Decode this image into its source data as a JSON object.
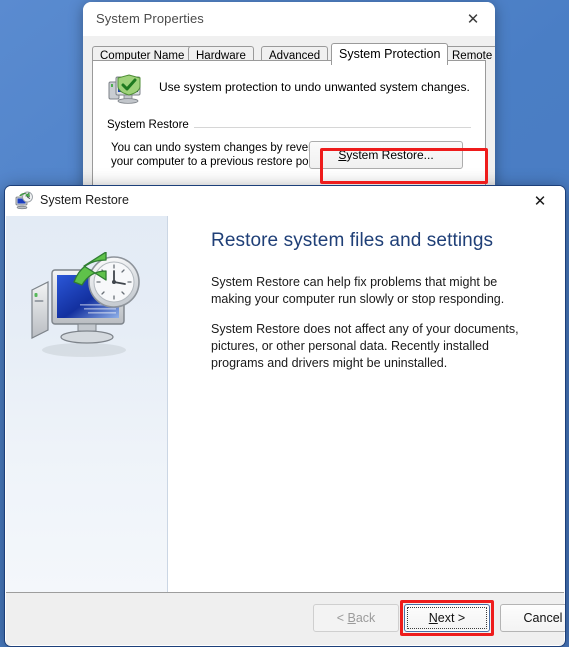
{
  "desktop": {
    "background_color": "#4d82c8"
  },
  "system_properties": {
    "title": "System Properties",
    "close_label": "✕",
    "tabs": [
      {
        "label": "Computer Name",
        "selected": false
      },
      {
        "label": "Hardware",
        "selected": false
      },
      {
        "label": "Advanced",
        "selected": false
      },
      {
        "label": "System Protection",
        "selected": true
      },
      {
        "label": "Remote",
        "selected": false
      }
    ],
    "header_text": "Use system protection to undo unwanted system changes.",
    "header_icon": "computer-shield-icon",
    "group": {
      "legend": "System Restore",
      "description": "You can undo system changes by reverting your computer to a previous restore point.",
      "button_label": "System Restore...",
      "button_accel": "S",
      "highlight_color": "#ee1c1c"
    }
  },
  "system_restore": {
    "title": "System Restore",
    "title_icon": "system-restore-icon",
    "close_label": "✕",
    "side_icon": "monitor-clock-restore-icon",
    "heading": "Restore system files and settings",
    "heading_color": "#1f3f77",
    "paragraph1": "System Restore can help fix problems that might be making your computer run slowly or stop responding.",
    "paragraph2": "System Restore does not affect any of your documents, pictures, or other personal data. Recently installed programs and drivers might be uninstalled.",
    "buttons": {
      "back": "< Back",
      "back_accel": "B",
      "next": "Next >",
      "next_accel": "N",
      "cancel": "Cancel"
    },
    "highlight_color": "#ee1c1c"
  }
}
